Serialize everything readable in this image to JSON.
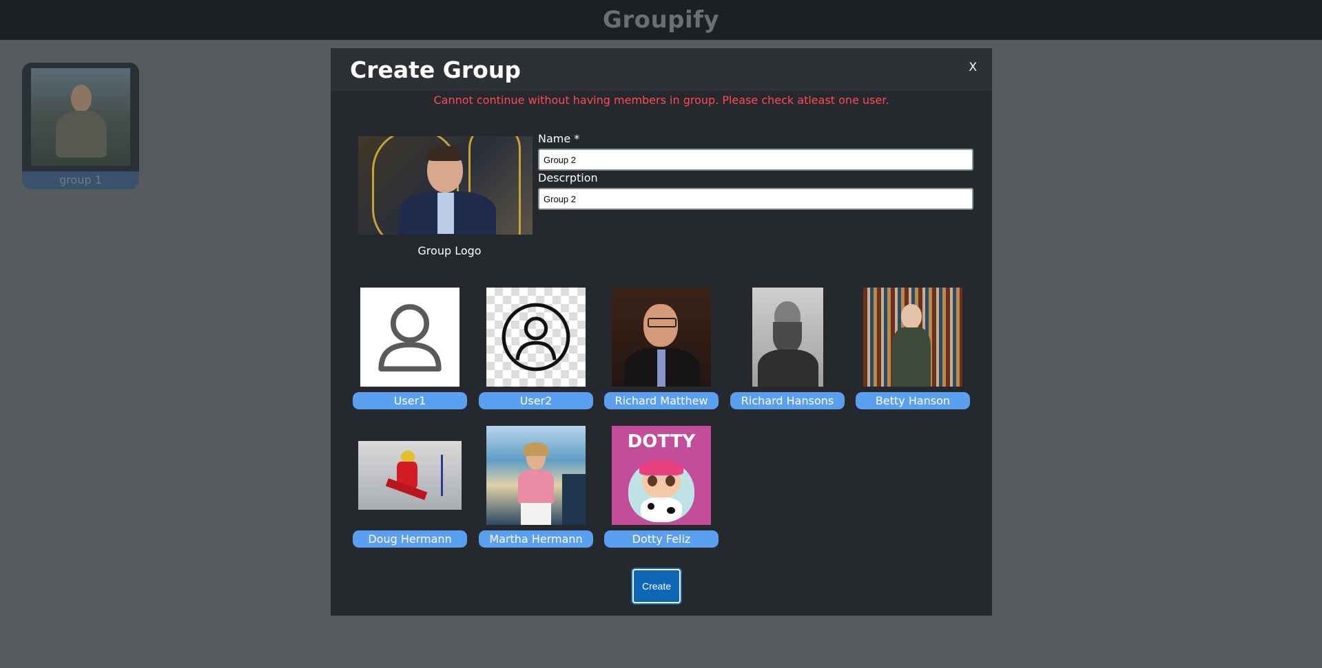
{
  "app": {
    "title": "Groupify"
  },
  "groups": [
    {
      "label": "group 1"
    }
  ],
  "modal": {
    "title": "Create Group",
    "close_label": "X",
    "error": "Cannot continue without having members in group. Please check atleast one user.",
    "logo_caption": "Group Logo",
    "name_label": "Name *",
    "name_value": "Group 2",
    "description_label": "Descrption",
    "description_value": "Group 2",
    "members": [
      {
        "name": "User1",
        "icon": "user-outline-icon"
      },
      {
        "name": "User2",
        "icon": "user-circle-icon"
      },
      {
        "name": "Richard Matthew"
      },
      {
        "name": "Richard Hansons"
      },
      {
        "name": "Betty Hanson"
      },
      {
        "name": "Doug Hermann"
      },
      {
        "name": "Martha Hermann"
      },
      {
        "name": "Dotty Feliz",
        "image_text": "DOTTY"
      }
    ],
    "create_label": "Create"
  },
  "colors": {
    "accent": "#5b9ff0",
    "error": "#ff4a57",
    "button": "#0f66b8"
  }
}
